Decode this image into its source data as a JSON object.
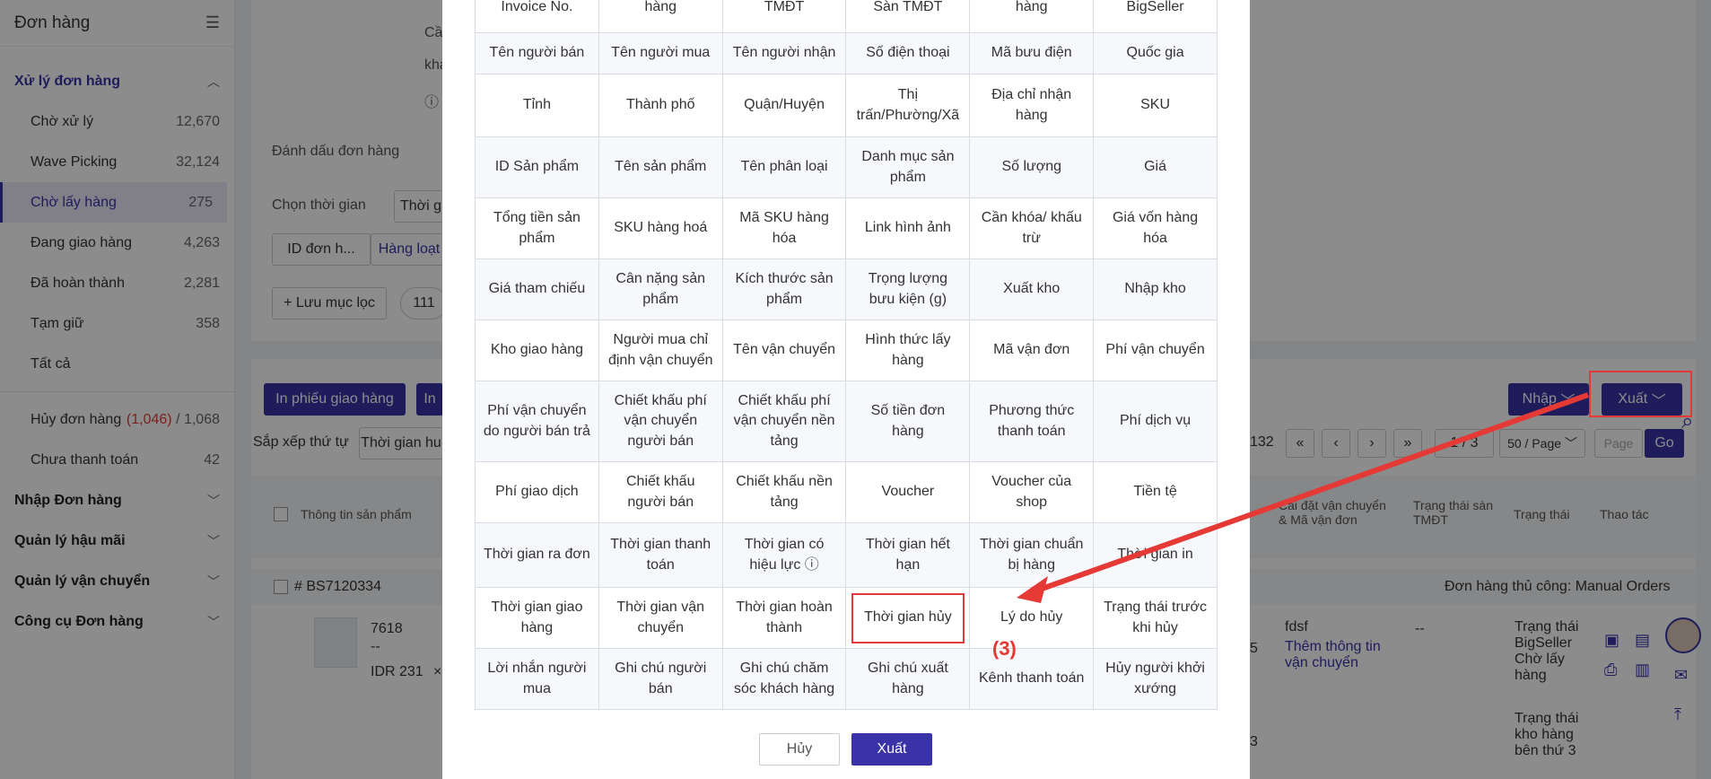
{
  "sidebar": {
    "title": "Đơn hàng",
    "group_active": "Xử lý đơn hàng",
    "items": [
      {
        "label": "Chờ xử lý",
        "count": "12,670"
      },
      {
        "label": "Wave Picking",
        "count": "32,124"
      },
      {
        "label": "Chờ lấy hàng",
        "count": "275"
      },
      {
        "label": "Đang giao hàng",
        "count": "4,263"
      },
      {
        "label": "Đã hoàn thành",
        "count": "2,281"
      },
      {
        "label": "Tạm giữ",
        "count": "358"
      },
      {
        "label": "Tất cả",
        "count": ""
      }
    ],
    "cancel_label": "Hủy đơn hàng",
    "cancel_pending": "(1,046)",
    "cancel_total": "/ 1,068",
    "unpaid_label": "Chưa thanh toán",
    "unpaid_count": "42",
    "groups": [
      "Nhập Đơn hàng",
      "Quản lý hậu mãi",
      "Quản lý vận chuyển",
      "Công cụ Đơn hàng"
    ]
  },
  "background": {
    "mark_order_label": "Đánh dấu đơn hàng",
    "choose_time_label": "Chọn thời gian",
    "time_select": "Thời g",
    "id_select": "ID đơn h...",
    "bulk_tab": "Hàng loạt",
    "save_filter": "+ Lưu mục lọc",
    "chip": "111",
    "text_ca": "Cầ",
    "text_kha": "khả",
    "print_delivery": "In phiếu giao hàng",
    "print_short": "In",
    "sort_label": "Sắp xếp thứ tự",
    "sort_value": "Thời gian hu",
    "import_btn": "Nhập",
    "export_btn": "Xuất",
    "total": "132",
    "page": "1 / 3",
    "per_page": "50 / Page",
    "page_placeholder": "Page",
    "go": "Go",
    "col_product": "Thông tin sản phẩm",
    "col_carrier": "Cài đặt vận chuyển & Mã vận đơn",
    "col_platform_status": "Trạng thái sàn TMĐT",
    "col_status": "Trạng thái",
    "col_actions": "Thao tác",
    "order_no": "# BS7120334",
    "manual_order": "Đơn hàng thủ công: Manual Orders",
    "prod_id": "7618",
    "prod_dash": "--",
    "prod_price": "IDR 231",
    "prod_x": "×",
    "row_5": "5",
    "row_3": "3",
    "carrier_text": "fdsf",
    "add_carrier": "Thêm thông tin vận chuyển",
    "status_dash": "--",
    "status_1": "Trạng thái BigSeller Chờ lấy hàng",
    "status_2": "Trạng thái kho hàng bên thứ 3"
  },
  "modal": {
    "rows": [
      [
        "Invoice No.",
        "hàng",
        "TMĐT",
        "Sàn TMĐT",
        "hàng",
        "BigSeller"
      ],
      [
        "Tên người bán",
        "Tên người mua",
        "Tên người nhận",
        "Số điện thoại",
        "Mã bưu điện",
        "Quốc gia"
      ],
      [
        "Tỉnh",
        "Thành phố",
        "Quận/Huyện",
        "Thị trấn/Phường/Xã",
        "Địa chỉ nhận hàng",
        "SKU"
      ],
      [
        "ID Sản phẩm",
        "Tên sản phẩm",
        "Tên phân loại",
        "Danh mục sản phẩm",
        "Số lượng",
        "Giá"
      ],
      [
        "Tổng tiền sản phẩm",
        "SKU hàng hoá",
        "Mã SKU hàng hóa",
        "Link hình ảnh",
        "Cần khóa/ khấu trừ",
        "Giá vốn hàng hóa"
      ],
      [
        "Giá tham chiếu",
        "Cân nặng sản phẩm",
        "Kích thước sản phẩm",
        "Trọng lượng bưu kiện (g)",
        "Xuất kho",
        "Nhập kho"
      ],
      [
        "Kho giao hàng",
        "Người mua chỉ định vận chuyển",
        "Tên vận chuyển",
        "Hình thức lấy hàng",
        "Mã vận đơn",
        "Phí vận chuyển"
      ],
      [
        "Phí vận chuyển do người bán trả",
        "Chiết khấu phí vận chuyển người bán",
        "Chiết khấu phí vận chuyển nền tảng",
        "Số tiền đơn hàng",
        "Phương thức thanh toán",
        "Phí dịch vụ"
      ],
      [
        "Phí giao dịch",
        "Chiết khấu người bán",
        "Chiết khấu nền tảng",
        "Voucher",
        "Voucher của shop",
        "Tiền tệ"
      ],
      [
        "Thời gian ra đơn",
        "Thời gian thanh toán",
        "Thời gian có hiệu lực ⓘ",
        "Thời gian hết hạn",
        "Thời gian chuẩn bị hàng",
        "Thời gian in"
      ],
      [
        "Thời gian giao hàng",
        "Thời gian vận chuyển",
        "Thời gian hoàn thành",
        "Thời gian hủy",
        "Lý do hủy",
        "Trạng thái trước khi hủy"
      ],
      [
        "Lời nhắn người mua",
        "Ghi chú người bán",
        "Ghi chú chăm sóc khách hàng",
        "Ghi chú xuất hàng",
        "Kênh thanh toán",
        "Hủy người khởi xướng"
      ]
    ],
    "cancel": "Hủy",
    "export": "Xuất",
    "step_label": "(3)"
  }
}
